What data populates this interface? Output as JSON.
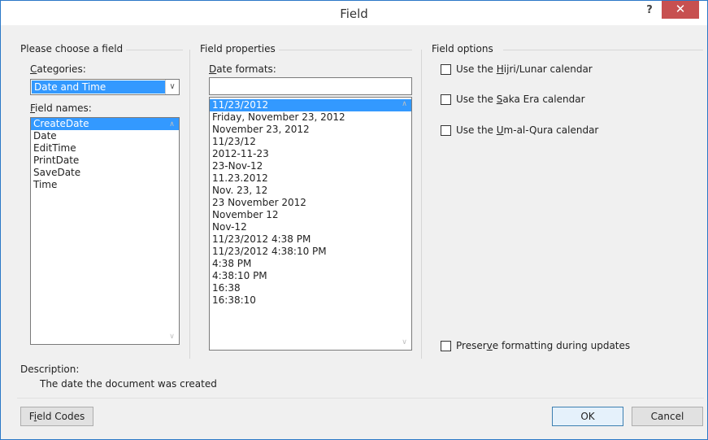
{
  "window": {
    "title": "Field",
    "help": "?",
    "close": "✕"
  },
  "left_panel": {
    "heading": "Please choose a field",
    "categories_label": {
      "key": "C",
      "rest": "ategories:"
    },
    "category_value": "Date and Time",
    "field_names_label": {
      "key": "F",
      "rest": "ield names:"
    },
    "field_names": [
      "CreateDate",
      "Date",
      "EditTime",
      "PrintDate",
      "SaveDate",
      "Time"
    ],
    "selected_field": "CreateDate"
  },
  "middle_panel": {
    "heading": "Field properties",
    "date_formats_label": {
      "key": "D",
      "rest": "ate formats:"
    },
    "date_format_input": "",
    "date_formats": [
      "11/23/2012",
      "Friday, November 23, 2012",
      "November 23, 2012",
      "11/23/12",
      "2012-11-23",
      "23-Nov-12",
      "11.23.2012",
      "Nov. 23, 12",
      "23 November 2012",
      "November 12",
      "Nov-12",
      "11/23/2012 4:38 PM",
      "11/23/2012 4:38:10 PM",
      "4:38 PM",
      "4:38:10 PM",
      "16:38",
      "16:38:10"
    ],
    "selected_format": "11/23/2012"
  },
  "right_panel": {
    "heading": "Field options",
    "options": [
      {
        "pre": "Use the ",
        "key": "H",
        "post": "ijri/Lunar calendar",
        "checked": false
      },
      {
        "pre": "Use the ",
        "key": "S",
        "post": "aka Era calendar",
        "checked": false
      },
      {
        "pre": "Use the ",
        "key": "U",
        "post": "m-al-Qura calendar",
        "checked": false
      }
    ],
    "preserve": {
      "pre": "Preser",
      "key": "v",
      "post": "e formatting during updates",
      "checked": false
    }
  },
  "description": {
    "label": "Description:",
    "text": "The date the document was created"
  },
  "buttons": {
    "field_codes": {
      "pre": "F",
      "key": "i",
      "post": "eld Codes"
    },
    "ok": "OK",
    "cancel": "Cancel"
  },
  "colors": {
    "selection": "#3399ff",
    "close": "#c75050",
    "border": "#2b78c7"
  }
}
